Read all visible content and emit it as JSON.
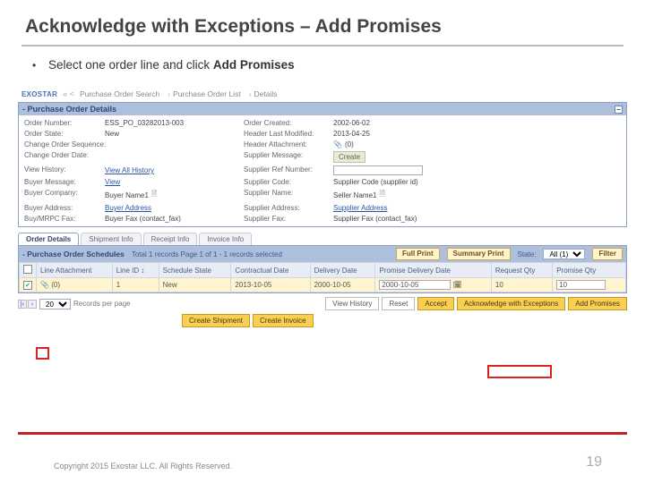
{
  "slide": {
    "title": "Acknowledge with Exceptions – Add Promises",
    "bullet_prefix": "Select one order line and click ",
    "bullet_bold": "Add Promises"
  },
  "breadcrumb": {
    "brand": "EXOSTAR",
    "nav_arrows": "« <",
    "items": [
      "Purchase Order Search",
      "Purchase Order List",
      "Details"
    ]
  },
  "po_details": {
    "panel_title": "- Purchase Order Details",
    "left": {
      "order_number_label": "Order Number:",
      "order_number": "ESS_PO_03282013-003",
      "order_state_label": "Order State:",
      "order_state": "New",
      "change_order_sequence_label": "Change Order Sequence:",
      "change_order_sequence": "",
      "change_order_date_label": "Change Order Date:",
      "change_order_date": "",
      "view_history_label": "View History:",
      "view_history": "View All History",
      "buyer_message_label": "Buyer Message:",
      "buyer_message": "View",
      "buyer_company_label": "Buyer Company:",
      "buyer_company": "Buyer Name1",
      "buyer_address_label": "Buyer Address:",
      "buyer_address": "Buyer Address",
      "buyer_mrpc_fax_label": "Buy/MRPC Fax:",
      "buyer_mrpc_fax": "Buyer Fax (contact_fax)"
    },
    "right": {
      "order_created_label": "Order Created:",
      "order_created": "2002-06-02",
      "header_last_modified_label": "Header Last Modified:",
      "header_last_modified": "2013-04-25",
      "header_attachment_label": "Header Attachment:",
      "header_attachment": "(0)",
      "supplier_message_label": "Supplier Message:",
      "supplier_message_btn": "Create",
      "supplier_ref_number_label": "Supplier Ref Number:",
      "supplier_ref_number": "",
      "supplier_code_label": "Supplier Code:",
      "supplier_code": "Supplier Code (supplier id)",
      "supplier_name_label": "Supplier Name:",
      "supplier_name": "Seller Name1",
      "supplier_address_label": "Supplier Address:",
      "supplier_address": "Supplier Address",
      "supplier_fax_label": "Supplier Fax:",
      "supplier_fax": "Supplier Fax (contact_fax)"
    }
  },
  "tabs": {
    "order_details": "Order Details",
    "shipment_info": "Shipment Info",
    "receipt_info": "Receipt Info",
    "invoice_info": "Invoice Info"
  },
  "schedules": {
    "panel_title": "- Purchase Order Schedules",
    "info": "Total 1 records Page 1 of 1 - 1 records selected",
    "full_print_btn": "Full Print",
    "summary_print_btn": "Summary Print",
    "state_label": "State:",
    "state_value": "All (1)",
    "filter_btn": "Filter",
    "columns": {
      "line_attachment": "Line Attachment",
      "line_id": "Line ID",
      "schedule_state": "Schedule State",
      "contractual_date": "Contractual Date",
      "delivery_date": "Delivery Date",
      "promise_delivery_date": "Promise Delivery Date",
      "request_qty": "Request Qty",
      "promise_qty": "Promise Qty"
    },
    "row": {
      "line_attachment": "(0)",
      "line_id": "1",
      "schedule_state": "New",
      "contractual_date": "2013-10-05",
      "delivery_date": "2000-10-05",
      "promise_delivery_date": "2000-10-05",
      "request_qty": "10",
      "promise_qty": "10"
    }
  },
  "pager": {
    "per_page": "20",
    "label": "Records per page"
  },
  "actions": {
    "view_history": "View History",
    "reset": "Reset",
    "accept": "Accept",
    "ack_exceptions": "Acknowledge with Exceptions",
    "add_promises": "Add Promises",
    "create_shipment": "Create Shipment",
    "create_invoice": "Create Invoice"
  },
  "footer": {
    "copyright": "Copyright 2015 Exostar LLC. All Rights Reserved.",
    "page": "19"
  }
}
